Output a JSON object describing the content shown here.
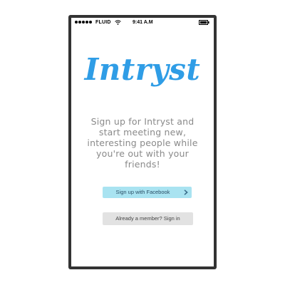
{
  "status_bar": {
    "carrier": "FLUID",
    "time": "9:41 A.M",
    "wifi_icon": "wifi-icon",
    "battery_icon": "battery-icon"
  },
  "app": {
    "logo": "Intryst",
    "tagline": "Sign up for Intryst and start meeting new, interesting people while you're out with your friends!",
    "facebook_button": {
      "label": "Sign up with Facebook",
      "icon": "chevron-right-icon"
    },
    "signin_button": {
      "label": "Already a member? Sign in"
    }
  },
  "colors": {
    "logo": "#2f9de6",
    "tagline": "#8a8a8a",
    "facebook_button_bg": "#a9e3f1",
    "signin_button_bg": "#e2e2e2",
    "phone_frame": "#333333"
  }
}
